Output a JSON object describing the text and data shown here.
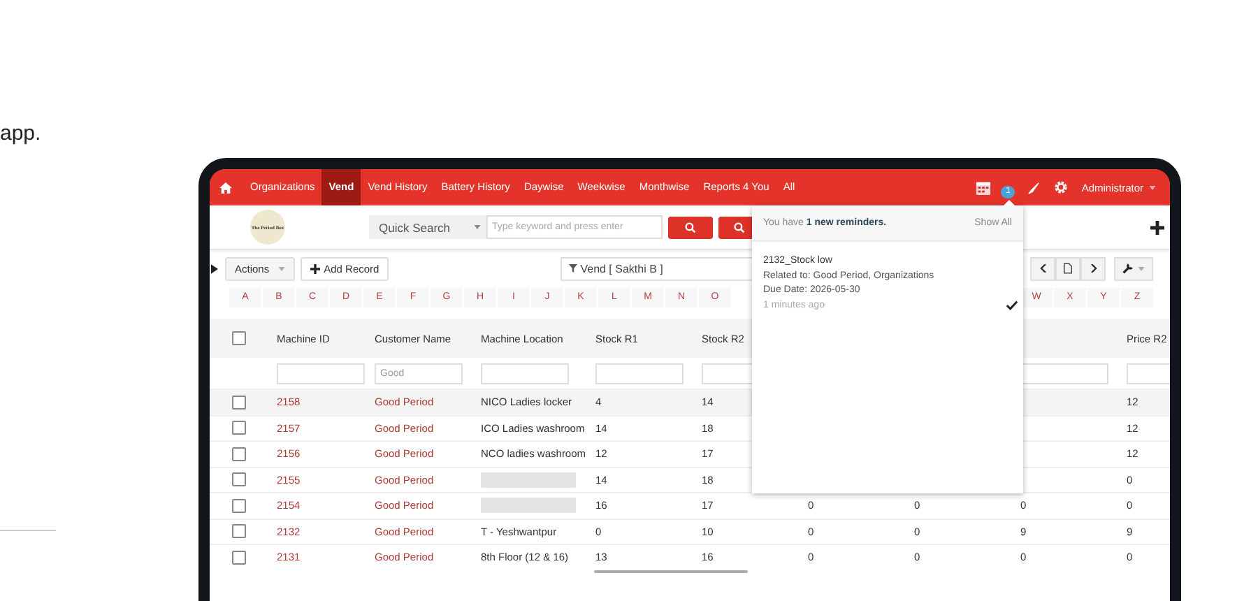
{
  "intro_text": "app.",
  "nav": {
    "items": [
      {
        "label": "Organizations",
        "selected": false
      },
      {
        "label": "Vend",
        "selected": true
      },
      {
        "label": "Vend History",
        "selected": false
      },
      {
        "label": "Battery History",
        "selected": false
      },
      {
        "label": "Daywise",
        "selected": false
      },
      {
        "label": "Weekwise",
        "selected": false
      },
      {
        "label": "Monthwise",
        "selected": false
      },
      {
        "label": "Reports 4 You",
        "selected": false
      },
      {
        "label": "All",
        "selected": false
      }
    ],
    "reminder_badge": "1",
    "user": "Administrator"
  },
  "logo_text": "The Period Box",
  "search": {
    "scope": "Quick Search",
    "placeholder": "Type keyword and press enter"
  },
  "toolbar": {
    "actions": "Actions",
    "add_record": "Add Record",
    "filter": "Vend [ Sakthi B ]"
  },
  "alphabet_left": [
    "A",
    "B",
    "C",
    "D",
    "E",
    "F",
    "G",
    "H",
    "I",
    "J",
    "K",
    "L",
    "M",
    "N",
    "O"
  ],
  "alphabet_right": [
    "W",
    "X",
    "Y",
    "Z"
  ],
  "table": {
    "header_checked": false,
    "columns": [
      {
        "label": "Machine ID"
      },
      {
        "label": "Customer Name"
      },
      {
        "label": "Machine Location"
      },
      {
        "label": "Stock R1"
      },
      {
        "label": "Stock R2"
      },
      {},
      {},
      {},
      {
        "label": "Price R2"
      }
    ],
    "filter_row": [
      {
        "kind": "input"
      },
      {
        "kind": "input",
        "value": "Good"
      },
      {
        "kind": "input"
      },
      {
        "kind": "input"
      },
      {
        "kind": "input"
      },
      {
        "kind": "covered"
      },
      {
        "kind": "covered"
      },
      {
        "kind": "input"
      },
      {
        "kind": "input"
      }
    ],
    "rows": [
      {
        "checked": false,
        "cells": [
          "2158",
          "Good Period",
          "NICO Ladies locker",
          "4",
          "14",
          null,
          null,
          null,
          "12"
        ]
      },
      {
        "checked": false,
        "cells": [
          "2157",
          "Good Period",
          "ICO Ladies washroom",
          "14",
          "18",
          null,
          null,
          null,
          "12"
        ]
      },
      {
        "checked": false,
        "cells": [
          "2156",
          "Good Period",
          "NCO ladies washroom",
          "12",
          "17",
          null,
          null,
          null,
          "12"
        ]
      },
      {
        "checked": false,
        "cells": [
          "2155",
          "Good Period",
          {
            "kind": "redacted"
          },
          "14",
          "18",
          null,
          null,
          null,
          "0"
        ]
      },
      {
        "checked": false,
        "cells": [
          "2154",
          "Good Period",
          {
            "kind": "redacted"
          },
          "16",
          "17",
          "0",
          "0",
          "0",
          "0"
        ]
      },
      {
        "checked": false,
        "cells": [
          "2132",
          "Good Period",
          "T - Yeshwantpur",
          "0",
          "10",
          "0",
          "0",
          "9",
          "9"
        ]
      },
      {
        "checked": false,
        "cells": [
          "2131",
          "Good Period",
          "8th Floor (12 & 16)",
          "13",
          "16",
          "0",
          "0",
          "0",
          "0"
        ]
      }
    ]
  },
  "reminders": {
    "summary": "You have **1 new reminders.**",
    "show_all": "Show All",
    "items": [
      {
        "title": "2132_Stock low",
        "related": "Related to: Good Period, Organizations",
        "due": "Due Date: 2026-05-30",
        "time": "1 minutes ago",
        "done": true
      }
    ]
  }
}
